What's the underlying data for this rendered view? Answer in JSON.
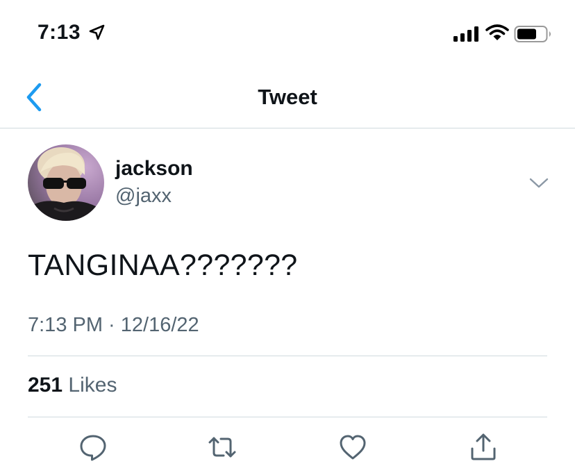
{
  "status_bar": {
    "time": "7:13",
    "icons": [
      "location-arrow-icon",
      "signal-icon",
      "wifi-icon",
      "battery-icon"
    ]
  },
  "nav": {
    "title": "Tweet",
    "back_icon": "chevron-left-icon"
  },
  "tweet": {
    "author_name": "jackson",
    "author_handle": "@jaxx",
    "text": "TANGINAA???????",
    "timestamp": "7:13 PM · 12/16/22",
    "likes_count": "251",
    "likes_label": "Likes"
  },
  "actions": [
    "reply-icon",
    "retweet-icon",
    "like-icon",
    "share-icon"
  ],
  "colors": {
    "accent": "#1d9bf0",
    "text_primary": "#0f1419",
    "text_secondary": "#536471",
    "divider": "#cfd9de"
  }
}
